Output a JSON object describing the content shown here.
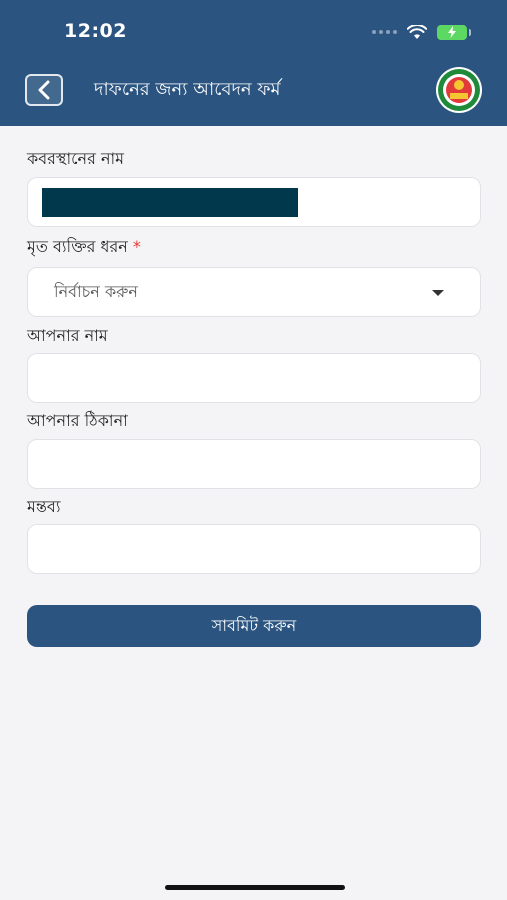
{
  "status_bar": {
    "time": "12:02"
  },
  "header": {
    "title": "দাফনের জন্য আবেদন ফর্ম",
    "back_icon": "chevron-left-icon",
    "logo_icon": "city-corporation-emblem-icon"
  },
  "form": {
    "fields": [
      {
        "label": "কবরস্থানের নাম",
        "value": "",
        "required": false
      },
      {
        "label": "মৃত ব্যক্তির ধরন",
        "required": true,
        "required_mark": "*",
        "selected": "নির্বাচন করুন"
      },
      {
        "label": "আপনার নাম",
        "value": "",
        "required": false
      },
      {
        "label": "আপনার ঠিকানা",
        "value": "",
        "required": false
      },
      {
        "label": "মন্তব্য",
        "value": "",
        "required": false
      }
    ],
    "submit_label": "সাবমিট করুন"
  },
  "colors": {
    "primary": "#2b5580",
    "background": "#f4f4f6",
    "required": "#e53935",
    "redaction": "#02384b"
  }
}
